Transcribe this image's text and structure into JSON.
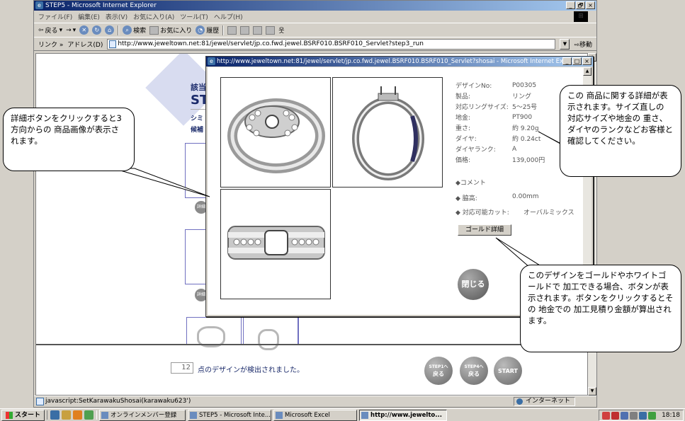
{
  "window": {
    "title": "STEP5 - Microsoft Internet Explorer",
    "minimize": "_",
    "restore": "🗗",
    "close": "×"
  },
  "menu": [
    "ファイル(F)",
    "編集(E)",
    "表示(V)",
    "お気に入り(A)",
    "ツール(T)",
    "ヘルプ(H)"
  ],
  "toolbar": {
    "back": "戻る",
    "forward": "→",
    "stop": "✕",
    "refresh": "↻",
    "home": "⌂",
    "search": "検索",
    "favorites": "お気に入り",
    "history": "履歴"
  },
  "address": {
    "links_label": "リンク »",
    "label": "アドレス(D)",
    "url": "http://www.jeweltown.net:81/jewel/servlet/jp.co.fwd.jewel.BSRF010.BSRF010_Servlet?step3_run",
    "go": "移動"
  },
  "page": {
    "bg_heading_1": "該当",
    "bg_heading_2": "ST",
    "bg_sub_1": "シミ",
    "bg_sub_2": "候補",
    "detail_mini": "詳細",
    "count": "12",
    "count_text": "点のデザインが検出されました。",
    "nav": [
      {
        "top": "STEP1へ",
        "bottom": "戻る"
      },
      {
        "top": "STEP4へ",
        "bottom": "戻る"
      },
      {
        "top": "",
        "bottom": "START"
      }
    ]
  },
  "popup": {
    "title": "http://www.jeweltown.net:81/jewel/servlet/jp.co.fwd.jewel.BSRF010.BSRF010_Servlet?shosai - Microsoft Internet Explorer",
    "specs": [
      {
        "label": "デザインNo:",
        "value": "P00305"
      },
      {
        "label": "製品:",
        "value": "リング"
      },
      {
        "label": "対応リングサイズ:",
        "value": "5～25号"
      },
      {
        "label": "地金:",
        "value": "PT900"
      },
      {
        "label": "重さ:",
        "value": "約 9.20g"
      },
      {
        "label": "ダイヤ:",
        "value": "約 0.24ct"
      },
      {
        "label": "ダイヤランク:",
        "value": "A"
      },
      {
        "label": "価格:",
        "value": "139,000円"
      }
    ],
    "comment_label": "◆コメント",
    "height_label": "◆ 脇高:",
    "height_value": "0.00mm",
    "cut_label": "◆ 対応可能カット:",
    "cut_value": "オーバルミックス",
    "gold_button": "ゴールド詳細",
    "close_button": "閉じる"
  },
  "callouts": {
    "left": "詳細ボタンをクリックすると3方向からの 商品画像が表示されます。",
    "right_top": "この 商品に関する詳細が表示されます。サイズ直しの 対応サイズや地金の 重さ、ダイヤのランクなどお客様と確認してください。",
    "right_bottom": "このデザインをゴールドやホワイトゴールドで 加工できる場合、ボタンが表示されます。ボタンをクリックするとその 地金での 加工見積り金額が算出されます。"
  },
  "status": {
    "text": "javascript:SetKarawakuShosai(karawaku623')",
    "zone": "インターネット"
  },
  "taskbar": {
    "start": "スタート",
    "tasks": [
      {
        "label": "オンラインメンバー登録",
        "active": false
      },
      {
        "label": "STEP5 - Microsoft Inte...",
        "active": false
      },
      {
        "label": "Microsoft Excel",
        "active": false
      },
      {
        "label": "http://www.jewelto...",
        "active": true
      }
    ],
    "clock": "18:18"
  },
  "colors": {
    "titlebar": "#0a246a",
    "accent_blue": "#1a2a6a",
    "callout_border": "#000000"
  }
}
